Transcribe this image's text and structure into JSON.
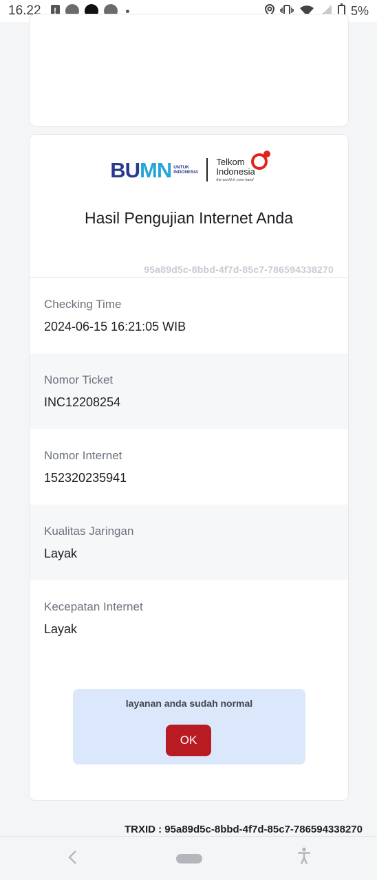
{
  "status_bar": {
    "time": "16.22",
    "battery_percent": "5%",
    "icons": [
      "alert-icon",
      "notification-dot-icon",
      "notification-dot-icon",
      "notification-dot-icon",
      "small-dot-icon",
      "location-icon",
      "vibrate-icon",
      "wifi-icon",
      "signal-icon",
      "battery-icon"
    ]
  },
  "logo": {
    "bumn_word_a": "BU",
    "bumn_word_b": "MN",
    "bumn_sub_1": "UNTUK",
    "bumn_sub_2": "INDONESIA",
    "telkom_line_1": "Telkom",
    "telkom_line_2": "Indonesia",
    "telkom_tagline": "the world in your hand"
  },
  "result": {
    "title": "Hasil Pengujian Internet Anda",
    "trx_small": "95a89d5c-8bbd-4f7d-85c7-786594338270",
    "rows": [
      {
        "label": "Checking Time",
        "value": "2024-06-15 16:21:05 WIB"
      },
      {
        "label": "Nomor Ticket",
        "value": "INC12208254"
      },
      {
        "label": "Nomor Internet",
        "value": "152320235941"
      },
      {
        "label": "Kualitas Jaringan",
        "value": "Layak"
      },
      {
        "label": "Kecepatan Internet",
        "value": "Layak"
      }
    ],
    "notice_text": "layanan anda sudah normal",
    "ok_label": "OK"
  },
  "footer": {
    "trxid": "TRXID : 95a89d5c-8bbd-4f7d-85c7-786594338270"
  },
  "nav": {
    "back_glyph": "‹",
    "access_glyph": "♿"
  },
  "colors": {
    "ok_button": "#b81c22",
    "notice_bg": "#dbe8fb",
    "shaded_row": "#f6f7f9"
  }
}
